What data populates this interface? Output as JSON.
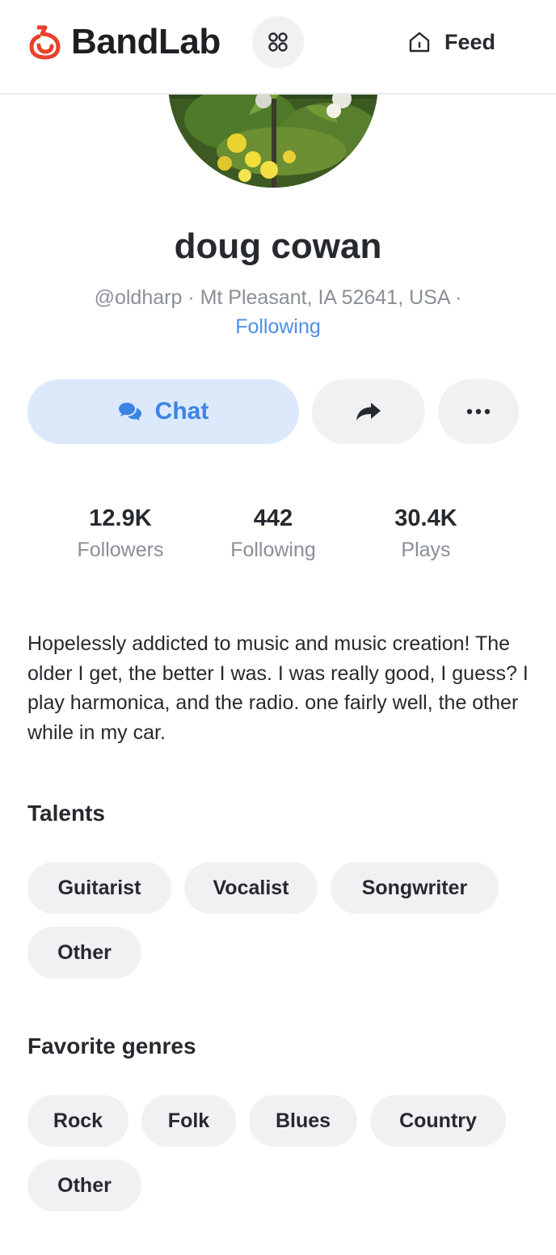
{
  "header": {
    "brand": "BandLab",
    "feed_label": "Feed"
  },
  "profile": {
    "name": "doug cowan",
    "handle_location": "@oldharp · Mt Pleasant, IA 52641, USA ·",
    "follow_status": "Following"
  },
  "actions": {
    "chat_label": "Chat"
  },
  "stats": [
    {
      "value": "12.9K",
      "label": "Followers"
    },
    {
      "value": "442",
      "label": "Following"
    },
    {
      "value": "30.4K",
      "label": "Plays"
    }
  ],
  "bio": "Hopelessly addicted to music and music creation! The older I get, the better I was. I was really good, I guess? I play harmonica, and the radio. one fairly well, the other while in my car.",
  "talents": {
    "title": "Talents",
    "items": [
      "Guitarist",
      "Vocalist",
      "Songwriter",
      "Other"
    ]
  },
  "genres": {
    "title": "Favorite genres",
    "items": [
      "Rock",
      "Folk",
      "Blues",
      "Country",
      "Other"
    ]
  },
  "colors": {
    "brand_red": "#e8412c",
    "accent_blue": "#3c83e6",
    "chip_bg": "#f0f1f3",
    "chat_bg": "#dce9fb"
  }
}
